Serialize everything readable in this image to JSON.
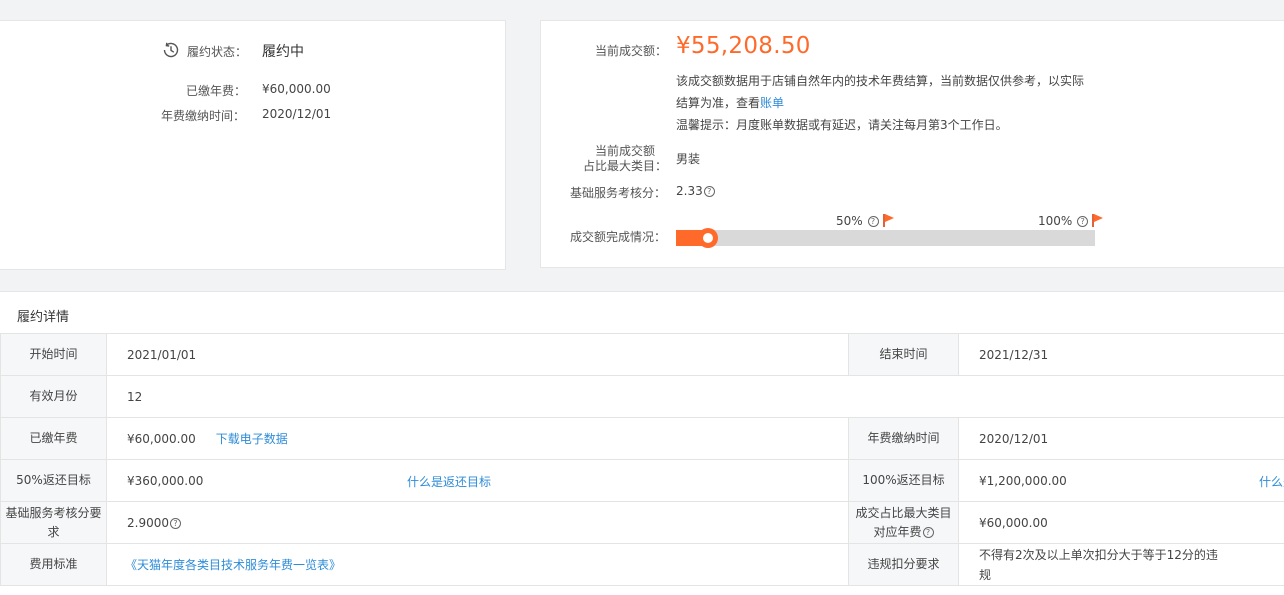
{
  "summary": {
    "status_label": "履约状态：",
    "status_value": "履约中",
    "paid_fee_label": "已缴年费：",
    "paid_fee_value": "¥60,000.00",
    "pay_time_label": "年费缴纳时间：",
    "pay_time_value": "2020/12/01"
  },
  "progress_card": {
    "current_amount_label": "当前成交额：",
    "current_amount_value": "¥55,208.50",
    "desc_line1": "该成交额数据用于店铺自然年内的技术年费结算，当前数据仅供参考，以实际",
    "desc_line2_prefix": "结算为准，查看",
    "desc_line2_link": "账单",
    "tip": "温馨提示：月度账单数据或有延迟，请关注每月第3个工作日。",
    "top_category_label_line1": "当前成交额",
    "top_category_label_line2": "占比最大类目：",
    "top_category_value": "男装",
    "service_score_label": "基础服务考核分：",
    "service_score_value": "2.33",
    "completion_label": "成交额完成情况：",
    "milestone_50_label": "50%",
    "milestone_100_label": "100%",
    "progress_fraction": 0.077,
    "accent_color": "#ff6a2b"
  },
  "detail": {
    "title": "履约详情",
    "rows": [
      {
        "l1": "开始时间",
        "v1": "2021/01/01",
        "l2": "结束时间",
        "v2": "2021/12/31"
      },
      {
        "l1": "有效月份",
        "v1": "12"
      },
      {
        "l1": "已缴年费",
        "v1": "¥60,000.00",
        "link1": "下载电子数据",
        "l2": "年费缴纳时间",
        "v2": "2020/12/01"
      },
      {
        "l1": "50%返还目标",
        "v1": "¥360,000.00",
        "link1": "什么是返还目标",
        "l2": "100%返还目标",
        "v2": "¥1,200,000.00",
        "link2": "什么是"
      },
      {
        "l1": "基础服务考核分要求",
        "v1": "2.9000",
        "l2_line1": "成交占比最大类目",
        "l2_line2": "对应年费",
        "v2": "¥60,000.00"
      },
      {
        "l1": "费用标准",
        "link1": "《天猫年度各类目技术服务年费一览表》",
        "l2": "违规扣分要求",
        "v2_line1": "不得有2次及以上单次扣分大于等于12分的违",
        "v2_line2": "规"
      }
    ]
  }
}
